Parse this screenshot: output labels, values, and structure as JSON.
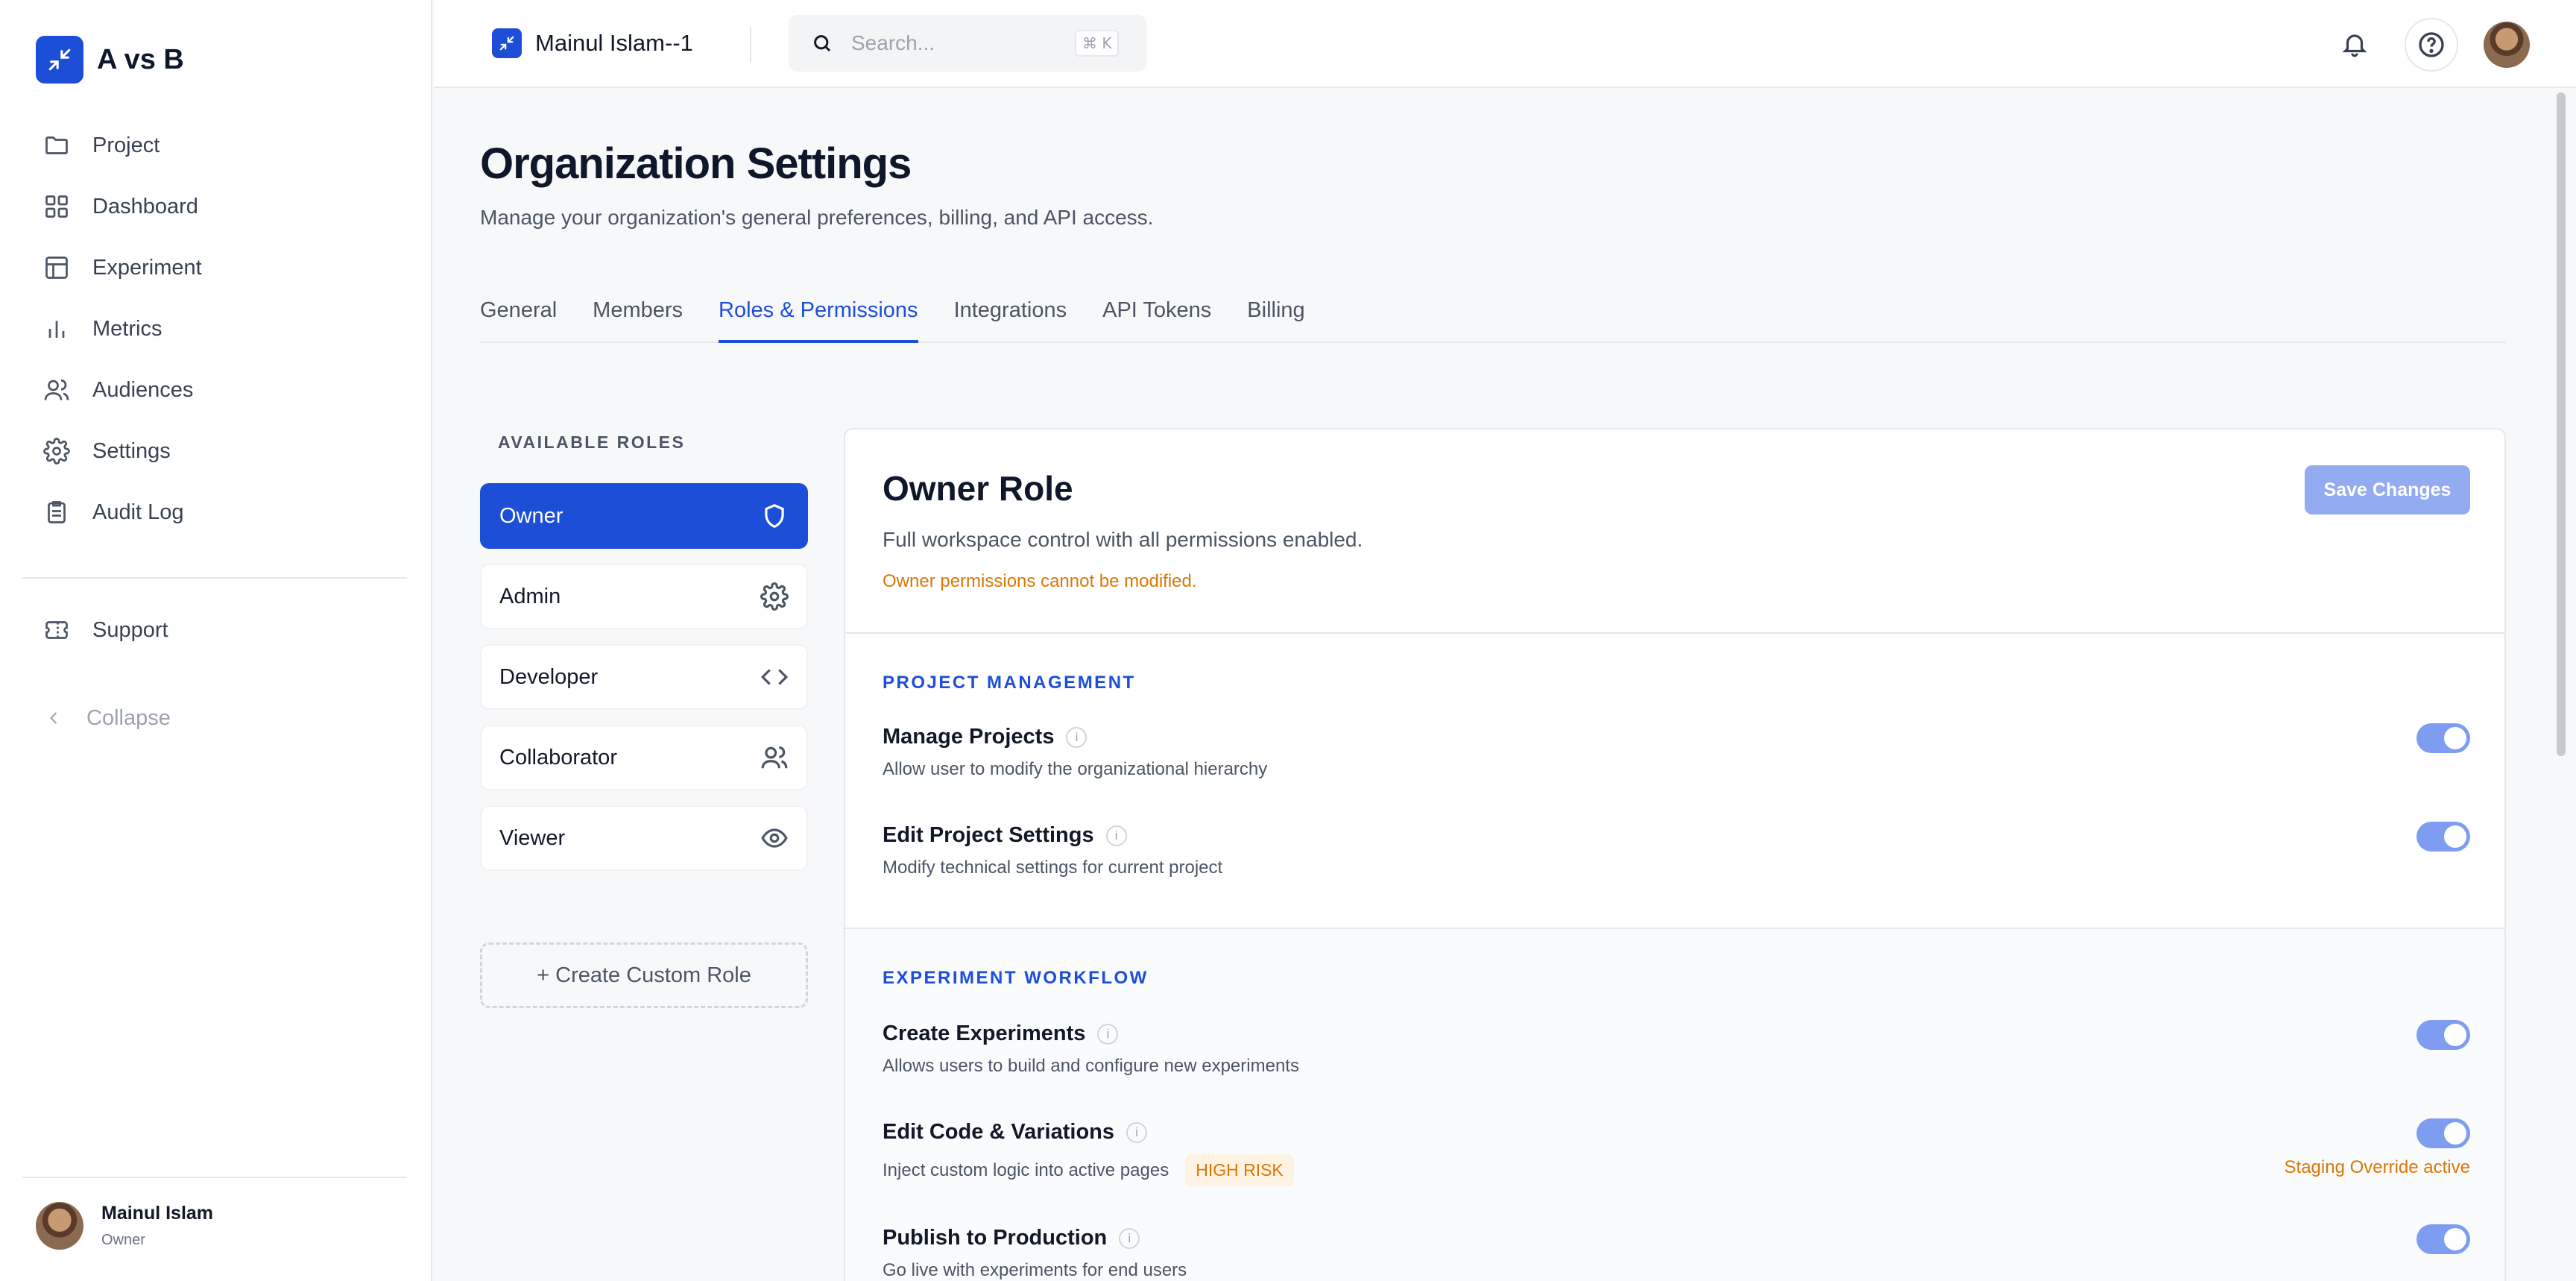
{
  "brand": {
    "name": "A vs B"
  },
  "sidebar": {
    "items": [
      {
        "label": "Project",
        "icon": "folder-icon"
      },
      {
        "label": "Dashboard",
        "icon": "dashboard-icon"
      },
      {
        "label": "Experiment",
        "icon": "table-icon"
      },
      {
        "label": "Metrics",
        "icon": "bar-chart-icon"
      },
      {
        "label": "Audiences",
        "icon": "users-icon"
      },
      {
        "label": "Settings",
        "icon": "gear-icon"
      },
      {
        "label": "Audit Log",
        "icon": "clipboard-icon"
      }
    ],
    "support_label": "Support",
    "collapse_label": "Collapse",
    "user": {
      "name": "Mainul Islam",
      "role": "Owner"
    }
  },
  "topbar": {
    "org_name": "Mainul Islam--1",
    "search_placeholder": "Search...",
    "search_shortcut": "⌘ K"
  },
  "page": {
    "title": "Organization Settings",
    "subtitle": "Manage your organization's general preferences, billing, and API access.",
    "tabs": [
      {
        "label": "General",
        "active": false
      },
      {
        "label": "Members",
        "active": false
      },
      {
        "label": "Roles & Permissions",
        "active": true
      },
      {
        "label": "Integrations",
        "active": false
      },
      {
        "label": "API Tokens",
        "active": false
      },
      {
        "label": "Billing",
        "active": false
      }
    ]
  },
  "roles": {
    "heading": "AVAILABLE ROLES",
    "items": [
      {
        "label": "Owner",
        "icon": "shield-icon",
        "active": true
      },
      {
        "label": "Admin",
        "icon": "gear-icon",
        "active": false
      },
      {
        "label": "Developer",
        "icon": "code-icon",
        "active": false
      },
      {
        "label": "Collaborator",
        "icon": "users-icon",
        "active": false
      },
      {
        "label": "Viewer",
        "icon": "eye-icon",
        "active": false
      }
    ],
    "create_label": "+ Create Custom Role"
  },
  "role_detail": {
    "title": "Owner Role",
    "description": "Full workspace control with all permissions enabled.",
    "warning": "Owner permissions cannot be modified.",
    "save_label": "Save Changes"
  },
  "sections": [
    {
      "title": "PROJECT MANAGEMENT",
      "permissions": [
        {
          "name": "Manage Projects",
          "description": "Allow user to modify the organizational hierarchy",
          "enabled": true
        },
        {
          "name": "Edit Project Settings",
          "description": "Modify technical settings for current project",
          "enabled": true
        }
      ]
    },
    {
      "title": "EXPERIMENT WORKFLOW",
      "permissions": [
        {
          "name": "Create Experiments",
          "description": "Allows users to build and configure new experiments",
          "enabled": true
        },
        {
          "name": "Edit Code & Variations",
          "description": "Inject custom logic into active pages",
          "badge": "HIGH RISK",
          "note": "Staging Override active",
          "enabled": true
        },
        {
          "name": "Publish to Production",
          "description": "Go live with experiments for end users",
          "enabled": true
        }
      ]
    }
  ],
  "colors": {
    "accent": "#1d4ed8",
    "warning": "#d97706",
    "toggle_on": "#7f9df0"
  }
}
